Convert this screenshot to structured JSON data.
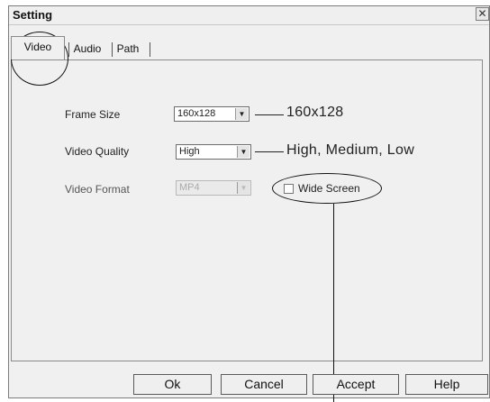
{
  "window": {
    "title": "Setting",
    "close_glyph": "✕"
  },
  "tabs": [
    {
      "label": "Video"
    },
    {
      "label": "Audio"
    },
    {
      "label": "Path"
    }
  ],
  "settings": {
    "frame_size": {
      "label": "Frame Size",
      "value": "160x128",
      "annotation": "160x128"
    },
    "video_quality": {
      "label": "Video Quality",
      "value": "High",
      "annotation": "High, Medium, Low"
    },
    "video_format": {
      "label": "Video Format",
      "value": "MP4",
      "disabled": true
    },
    "wide_screen": {
      "label": "Wide Screen",
      "checked": false
    }
  },
  "buttons": {
    "ok": "Ok",
    "cancel": "Cancel",
    "accept": "Accept",
    "help": "Help"
  },
  "icons": {
    "dropdown": "chevron-down-icon",
    "close": "close-icon"
  }
}
